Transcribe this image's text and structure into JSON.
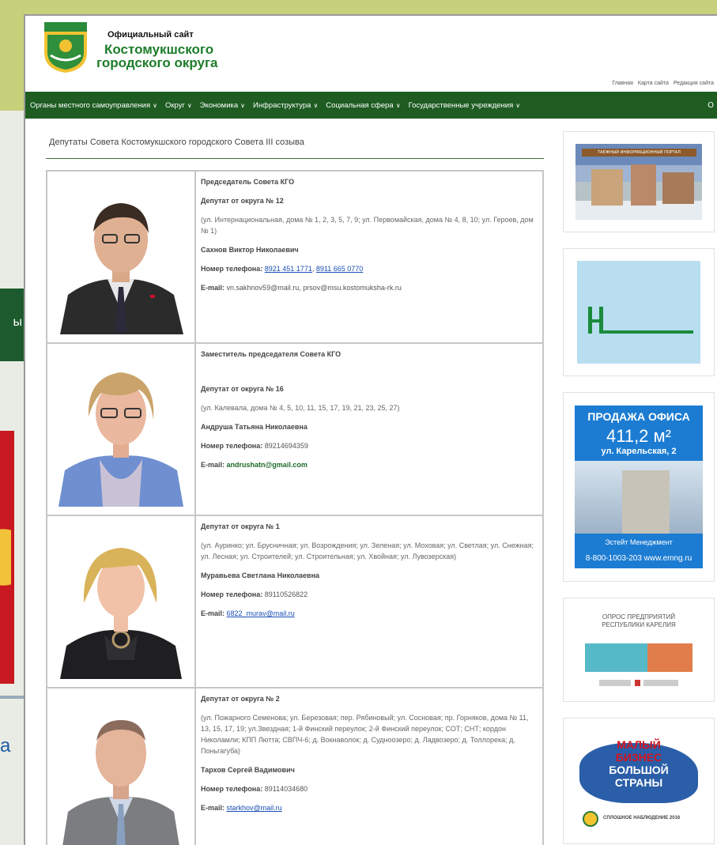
{
  "site": {
    "brand_small": "Официальный сайт",
    "brand_line1": "Костомукшского",
    "brand_line2": "городского округа",
    "top_links": [
      "Главная",
      "Карта сайта",
      "Редакция сайта"
    ]
  },
  "nav": {
    "items": [
      {
        "label": "Органы местного самоуправления"
      },
      {
        "label": "Округ"
      },
      {
        "label": "Экономика"
      },
      {
        "label": "Инфраструктура"
      },
      {
        "label": "Социальная сфера"
      },
      {
        "label": "Государственные учреждения"
      }
    ],
    "extra": "О"
  },
  "page": {
    "title": "Депутаты Совета Костомукшского городского Совета III созыва"
  },
  "deputies": [
    {
      "role": "Председатель Совета КГО",
      "district": "Депутат от округа № 12",
      "address": "(ул. Интернациональная, дома № 1, 2, 3, 5, 7, 9; ул. Первомайская, дома № 4, 8, 10; ул. Героев, дом № 1)",
      "name": "Сахнов Виктор Николаевич",
      "phone_label": "Номер телефона:",
      "phone_1": "8921 451 1771",
      "phone_2": "8911 665 0770",
      "email_label": "E-mail:",
      "email": "vn.sakhnov59@mail.ru, prsov@msu.kostomuksha-rk.ru"
    },
    {
      "role": "Заместитель председателя Совета КГО",
      "district": "Депутат от округа № 16",
      "address": "(ул. Калевала, дома № 4, 5, 10, 11, 15, 17, 19, 21, 23, 25, 27)",
      "name": "Андруша Татьяна Николаевна",
      "phone_label": "Номер телефона:",
      "phone": "89214694359",
      "email_label": "E-mail:",
      "email": "andrushatn@gmail.com"
    },
    {
      "district": "Депутат от округа № 1",
      "address": "(ул. Ауринко; ул. Брусничная; ул. Возрождения; ул. Зеленая; ул. Моховая; ул. Светлая; ул. Снежная; ул. Лесная; ул. Строителей; ул. Строительная; ул. Хвойная; ул. Лувозерская)",
      "name": "Муравьева Светлана Николаевна",
      "phone_label": "Номер телефона:",
      "phone": "89110526822",
      "email_label": "E-mail:",
      "email": "6822_murav@mail.ru"
    },
    {
      "district": "Депутат от округа № 2",
      "address": "(ул. Пожарного Семенова; ул. Березовая; пер. Рябиновый; ул. Сосновая; пр. Горняков, дома № 11, 13, 15, 17, 19; ул.Звездная; 1-й Финский переулок; 2-й Финский переулок; СОТ; СНТ; кордон Николамли; КПП Лютта; СВПЧ-6; д. Вокнаволок; д. Судноозеро; д. Ладвозеро; д. Толлорека; д. Поньгагуба)",
      "name": "Тархов Сергей Вадимович",
      "phone_label": "Номер телефона:",
      "phone": "89114034680",
      "email_label": "E-mail:",
      "email": "starkhov@mail.ru"
    }
  ],
  "sidebar": {
    "office": {
      "title": "ПРОДАЖА ОФИСА",
      "area": "411,2 м²",
      "street": "ул. Карельская, 2",
      "company": "Эстейт Менеджмент",
      "contacts": "8-800-1003-203  www.emng.ru"
    },
    "poll": {
      "title_1": "ОПРОС ПРЕДПРИЯТИЙ",
      "title_2": "РЕСПУБЛИКИ КАРЕЛИЯ"
    },
    "biz": {
      "l1": "МАЛЫЙ",
      "l2": "БИЗНЕС",
      "l3": "БОЛЬШОЙ",
      "l4": "СТРАНЫ",
      "footer": "СПЛОШНОЕ НАБЛЮДЕНИЕ 2016"
    },
    "town": {
      "header": "ТАЕЖНЫЙ ИНФОРМАЦИОННЫЙ ПОРТАЛ"
    }
  },
  "background": {
    "left_text_1": "ы",
    "left_text_2": "а"
  }
}
